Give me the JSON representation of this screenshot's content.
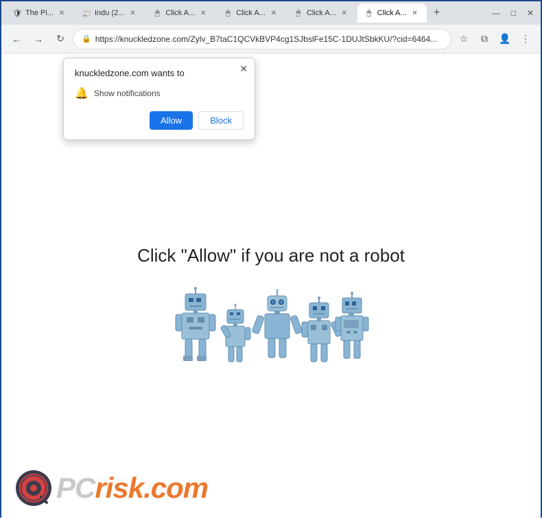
{
  "titleBar": {
    "tabs": [
      {
        "id": "tab1",
        "favicon": "🛡",
        "label": "The Pi...",
        "active": false,
        "closable": true
      },
      {
        "id": "tab2",
        "favicon": "📰",
        "label": "Indu (2...",
        "active": false,
        "closable": true
      },
      {
        "id": "tab3",
        "favicon": "🖱",
        "label": "Click A...",
        "active": false,
        "closable": true
      },
      {
        "id": "tab4",
        "favicon": "🖱",
        "label": "Click A...",
        "active": false,
        "closable": true
      },
      {
        "id": "tab5",
        "favicon": "🖱",
        "label": "Click A...",
        "active": false,
        "closable": true
      },
      {
        "id": "tab6",
        "favicon": "🖱",
        "label": "Click A...",
        "active": true,
        "closable": true
      }
    ],
    "newTabLabel": "+",
    "windowControls": {
      "minimize": "—",
      "maximize": "□",
      "close": "✕"
    }
  },
  "navBar": {
    "backDisabled": false,
    "forwardDisabled": false,
    "address": "https://knuckledzone.com/Zylv_B7taC1QCVkBVP4cg1SJbslFe15C-1DUJtSbkKU/?cid=6464...",
    "lockIcon": "🔒"
  },
  "popup": {
    "title": "knuckledzone.com wants to",
    "permission": "Show notifications",
    "allowLabel": "Allow",
    "blockLabel": "Block",
    "closeSymbol": "✕"
  },
  "pageContent": {
    "headline": "Click \"Allow\"   if you are not   a robot"
  },
  "watermark": {
    "pcText": "PC",
    "riskText": "risk.com"
  }
}
